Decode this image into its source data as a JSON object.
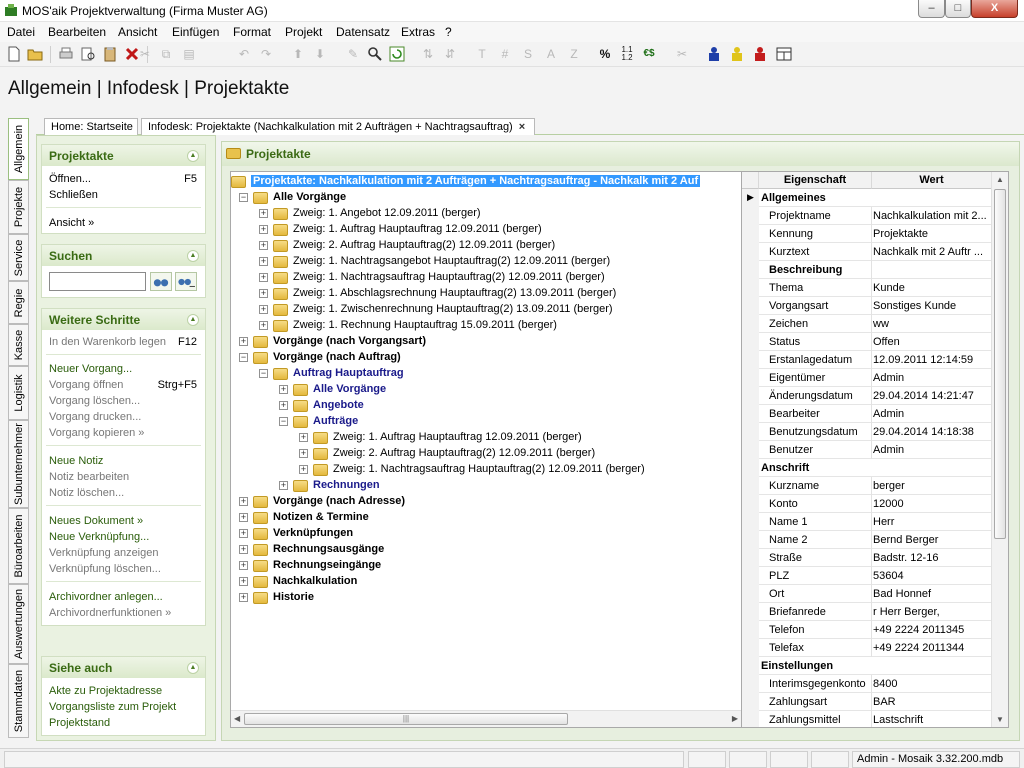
{
  "window": {
    "title": "MOS'aik Projektverwaltung (Firma Muster AG)",
    "min": "–",
    "max": "□",
    "close": "X"
  },
  "menu": [
    "Datei",
    "Bearbeiten",
    "Ansicht",
    "Einfügen",
    "Format",
    "Projekt",
    "Datensatz",
    "Extras",
    "?"
  ],
  "toolbar": {
    "text_buttons": [
      "T",
      "#",
      "S",
      "A",
      "Z",
      "%"
    ],
    "currency": "€$"
  },
  "page_title": "Allgemein | Infodesk | Projektakte",
  "tabs": [
    {
      "label": "Home: Startseite"
    },
    {
      "label": "Infodesk: Projektakte (Nachkalkulation mit 2 Aufträgen + Nachtragsauftrag)",
      "close": "×"
    }
  ],
  "vtabs": [
    "Allgemein",
    "Projekte",
    "Service",
    "Regie",
    "Kasse",
    "Logistik",
    "Subunternehmer",
    "Büroarbeiten",
    "Auswertungen",
    "Stammdaten"
  ],
  "leftnav": {
    "projektakte": {
      "title": "Projektakte",
      "items": [
        {
          "label": "Öffnen...",
          "key": "F5"
        },
        {
          "label": "Schließen"
        },
        {
          "label": "Ansicht »"
        }
      ]
    },
    "suchen": {
      "title": "Suchen",
      "input": ""
    },
    "weitere": {
      "title": "Weitere Schritte",
      "items": [
        {
          "label": "In den Warenkorb legen",
          "key": "F12"
        },
        {
          "label": "Neuer Vorgang..."
        },
        {
          "label": "Vorgang öffnen",
          "key": "Strg+F5"
        },
        {
          "label": "Vorgang löschen..."
        },
        {
          "label": "Vorgang drucken..."
        },
        {
          "label": "Vorgang kopieren »"
        },
        {
          "label": "Neue Notiz"
        },
        {
          "label": "Notiz bearbeiten"
        },
        {
          "label": "Notiz löschen..."
        },
        {
          "label": "Neues Dokument »"
        },
        {
          "label": "Neue Verknüpfung..."
        },
        {
          "label": "Verknüpfung anzeigen"
        },
        {
          "label": "Verknüpfung löschen..."
        },
        {
          "label": "Archivordner anlegen..."
        },
        {
          "label": "Archivordnerfunktionen »"
        }
      ]
    },
    "siehe": {
      "title": "Siehe auch",
      "items": [
        {
          "label": "Akte zu Projektadresse"
        },
        {
          "label": "Vorgangsliste zum Projekt"
        },
        {
          "label": "Projektstand"
        }
      ]
    }
  },
  "main": {
    "title": "Projektakte",
    "tree": [
      {
        "label": "Projektakte: Nachkalkulation mit 2 Aufträgen + Nachtragsauftrag - Nachkalk mit 2 Auf",
        "sel": true
      },
      {
        "label": "Alle Vorgänge",
        "b": 1,
        "pm": "−"
      },
      {
        "label": "Zweig: 1. Angebot 12.09.2011 (berger)",
        "pm": "+"
      },
      {
        "label": "Zweig: 1. Auftrag Hauptauftrag 12.09.2011 (berger)",
        "pm": "+"
      },
      {
        "label": "Zweig: 2. Auftrag Hauptauftrag(2) 12.09.2011 (berger)",
        "pm": "+"
      },
      {
        "label": "Zweig: 1. Nachtragsangebot Hauptauftrag(2) 12.09.2011 (berger)",
        "pm": "+"
      },
      {
        "label": "Zweig: 1. Nachtragsauftrag Hauptauftrag(2) 12.09.2011 (berger)",
        "pm": "+"
      },
      {
        "label": "Zweig: 1. Abschlagsrechnung Hauptauftrag(2) 13.09.2011 (berger)",
        "pm": "+"
      },
      {
        "label": "Zweig: 1. Zwischenrechnung Hauptauftrag(2) 13.09.2011 (berger)",
        "pm": "+"
      },
      {
        "label": "Zweig: 1. Rechnung Hauptauftrag 15.09.2011 (berger)",
        "pm": "+"
      },
      {
        "label": "Vorgänge (nach Vorgangsart)",
        "b": 1,
        "pm": "+"
      },
      {
        "label": "Vorgänge (nach Auftrag)",
        "b": 1,
        "pm": "−"
      },
      {
        "label": "Auftrag  Hauptauftrag",
        "n": 1,
        "pm": "−"
      },
      {
        "label": "Alle Vorgänge",
        "n": 1,
        "pm": "+"
      },
      {
        "label": "Angebote",
        "n": 1,
        "pm": "+"
      },
      {
        "label": "Aufträge",
        "n": 1,
        "pm": "−"
      },
      {
        "label": "Zweig: 1. Auftrag Hauptauftrag 12.09.2011 (berger)",
        "pm": "+"
      },
      {
        "label": "Zweig: 2. Auftrag Hauptauftrag(2) 12.09.2011 (berger)",
        "pm": "+"
      },
      {
        "label": "Zweig: 1. Nachtragsauftrag Hauptauftrag(2) 12.09.2011 (berger)",
        "pm": "+"
      },
      {
        "label": "Rechnungen",
        "n": 1,
        "pm": "+"
      },
      {
        "label": "Vorgänge (nach Adresse)",
        "b": 1,
        "pm": "+"
      },
      {
        "label": "Notizen & Termine",
        "b": 1,
        "pm": "+"
      },
      {
        "label": "Verknüpfungen",
        "b": 1,
        "pm": "+"
      },
      {
        "label": "Rechnungsausgänge",
        "b": 1,
        "pm": "+"
      },
      {
        "label": "Rechnungseingänge",
        "b": 1,
        "pm": "+"
      },
      {
        "label": "Nachkalkulation",
        "b": 1,
        "pm": "+"
      },
      {
        "label": "Historie",
        "b": 1,
        "pm": "+"
      }
    ],
    "props_head": [
      "Eigenschaft",
      "Wert"
    ],
    "props": [
      {
        "k": "Allgemeines",
        "cat": true,
        "arrow": "▶"
      },
      {
        "k": "Projektname",
        "v": "Nachkalkulation mit 2..."
      },
      {
        "k": "Kennung",
        "v": "Projektakte"
      },
      {
        "k": "Kurztext",
        "v": "Nachkalk mit 2 Auftr ..."
      },
      {
        "k": "Beschreibung",
        "bold": true
      },
      {
        "k": "Thema",
        "v": "Kunde"
      },
      {
        "k": "Vorgangsart",
        "v": "Sonstiges Kunde"
      },
      {
        "k": "Zeichen",
        "v": "ww"
      },
      {
        "k": "Status",
        "v": "Offen"
      },
      {
        "k": "Erstanlagedatum",
        "v": "12.09.2011 12:14:59"
      },
      {
        "k": "Eigentümer",
        "v": "Admin"
      },
      {
        "k": "Änderungsdatum",
        "v": "29.04.2014 14:21:47"
      },
      {
        "k": "Bearbeiter",
        "v": "Admin"
      },
      {
        "k": "Benutzungsdatum",
        "v": "29.04.2014 14:18:38"
      },
      {
        "k": "Benutzer",
        "v": "Admin"
      },
      {
        "k": "Anschrift",
        "cat": true
      },
      {
        "k": "Kurzname",
        "v": "berger"
      },
      {
        "k": "Konto",
        "v": "12000"
      },
      {
        "k": "Name 1",
        "v": "Herr"
      },
      {
        "k": "Name 2",
        "v": "Bernd Berger"
      },
      {
        "k": "Straße",
        "v": "Badstr. 12-16"
      },
      {
        "k": "PLZ",
        "v": "53604"
      },
      {
        "k": "Ort",
        "v": "Bad Honnef"
      },
      {
        "k": "Briefanrede",
        "v": "r Herr Berger,"
      },
      {
        "k": "Telefon",
        "v": "+49 2224 2011345"
      },
      {
        "k": "Telefax",
        "v": "+49 2224 2011344"
      },
      {
        "k": "Einstellungen",
        "cat": true
      },
      {
        "k": "Interimsgegenkonto",
        "v": "8400"
      },
      {
        "k": "Zahlungsart",
        "v": "BAR"
      },
      {
        "k": "Zahlungsmittel",
        "v": "Lastschrift"
      }
    ]
  },
  "statusbar": {
    "text": "Admin - Mosaik 3.32.200.mdb"
  }
}
